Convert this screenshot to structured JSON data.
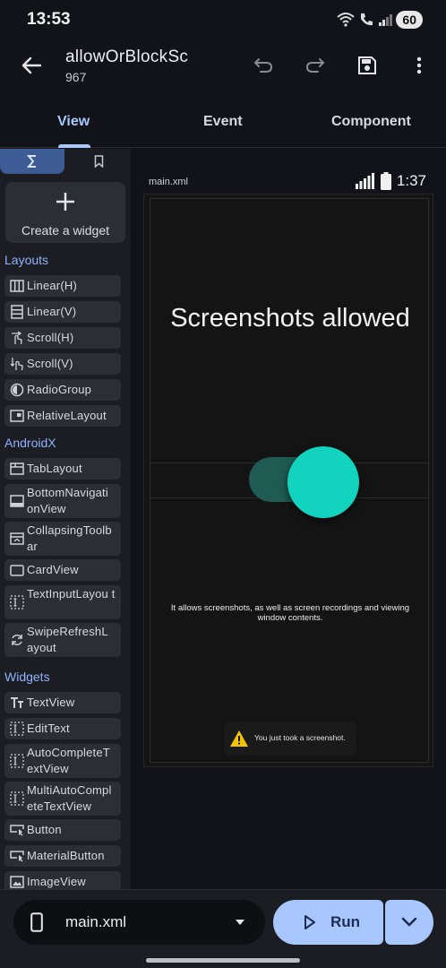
{
  "status_bar": {
    "time": "13:53",
    "battery": "60"
  },
  "app_bar": {
    "title": "allowOrBlockSc",
    "subtitle": "967"
  },
  "tabs": [
    {
      "label": "View"
    },
    {
      "label": "Event"
    },
    {
      "label": "Component"
    }
  ],
  "sidebar": {
    "create_widget_label": "Create a widget",
    "sections": {
      "layouts": "Layouts",
      "androidx": "AndroidX",
      "widgets": "Widgets"
    },
    "layouts": [
      "Linear(H)",
      "Linear(V)",
      "Scroll(H)",
      "Scroll(V)",
      "RadioGroup",
      "RelativeLayout"
    ],
    "androidx": [
      "TabLayout",
      "BottomNavigati onView",
      "CollapsingToolb ar",
      "CardView",
      "TextInputLayou t",
      "SwipeRefreshL ayout"
    ],
    "widgets": [
      "TextView",
      "EditText",
      "AutoCompleteT extView",
      "MultiAutoCompl eteTextView",
      "Button",
      "MaterialButton",
      "ImageView"
    ]
  },
  "preview": {
    "file_label": "main.xml",
    "time": "1:37",
    "title": "Screenshots allowed",
    "switch_checked": true,
    "description": "It allows screenshots, as well as screen recordings and viewing window contents.",
    "toast": "You just took a screenshot."
  },
  "bottom_bar": {
    "file_name": "main.xml",
    "run_label": "Run"
  },
  "colors": {
    "accent": "#a9c7ff",
    "switch_thumb": "#12d4be",
    "switch_track": "#1f5a53",
    "section": "#8fb2ff"
  }
}
